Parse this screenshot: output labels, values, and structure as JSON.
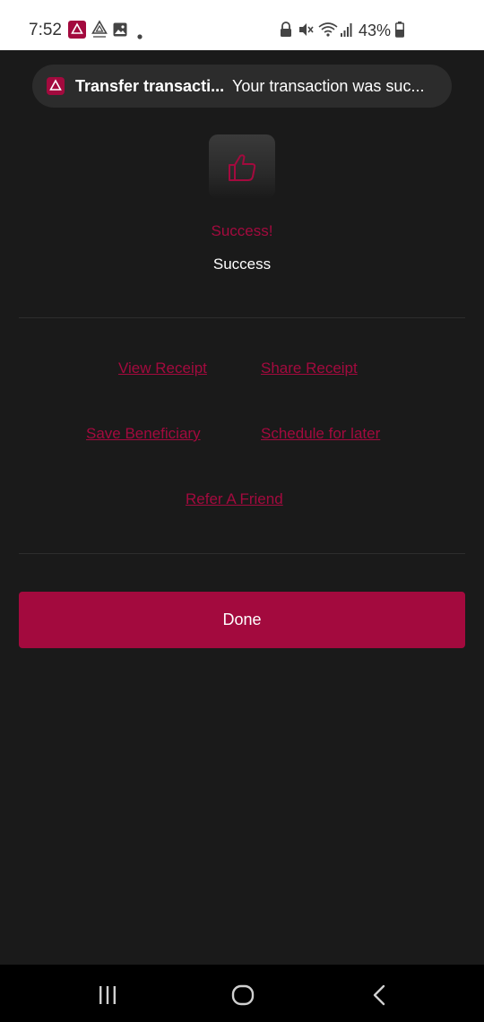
{
  "status_bar": {
    "time": "7:52",
    "battery": "43%",
    "icons": [
      "alat-app-icon",
      "alat-logo-icon",
      "gallery-icon",
      "notification-dot-icon",
      "lock-icon",
      "mute-icon",
      "wifi-icon",
      "signal-icon",
      "battery-icon"
    ]
  },
  "notification": {
    "app_icon": "alat-app-icon",
    "title": "Transfer transacti...",
    "body": "Your transaction was suc..."
  },
  "result": {
    "icon": "thumbs-up-icon",
    "heading": "Success!",
    "message": "Success"
  },
  "actions": {
    "view_receipt": "View Receipt",
    "share_receipt": "Share Receipt",
    "save_beneficiary": "Save Beneficiary",
    "schedule_later": "Schedule for later",
    "refer_friend": "Refer A Friend"
  },
  "done_label": "Done",
  "nav_bar": {
    "icons": [
      "recent-apps-icon",
      "home-icon",
      "back-icon"
    ]
  },
  "colors": {
    "accent": "#a30a3e",
    "background": "#1a1a1a",
    "text": "#ffffff"
  }
}
